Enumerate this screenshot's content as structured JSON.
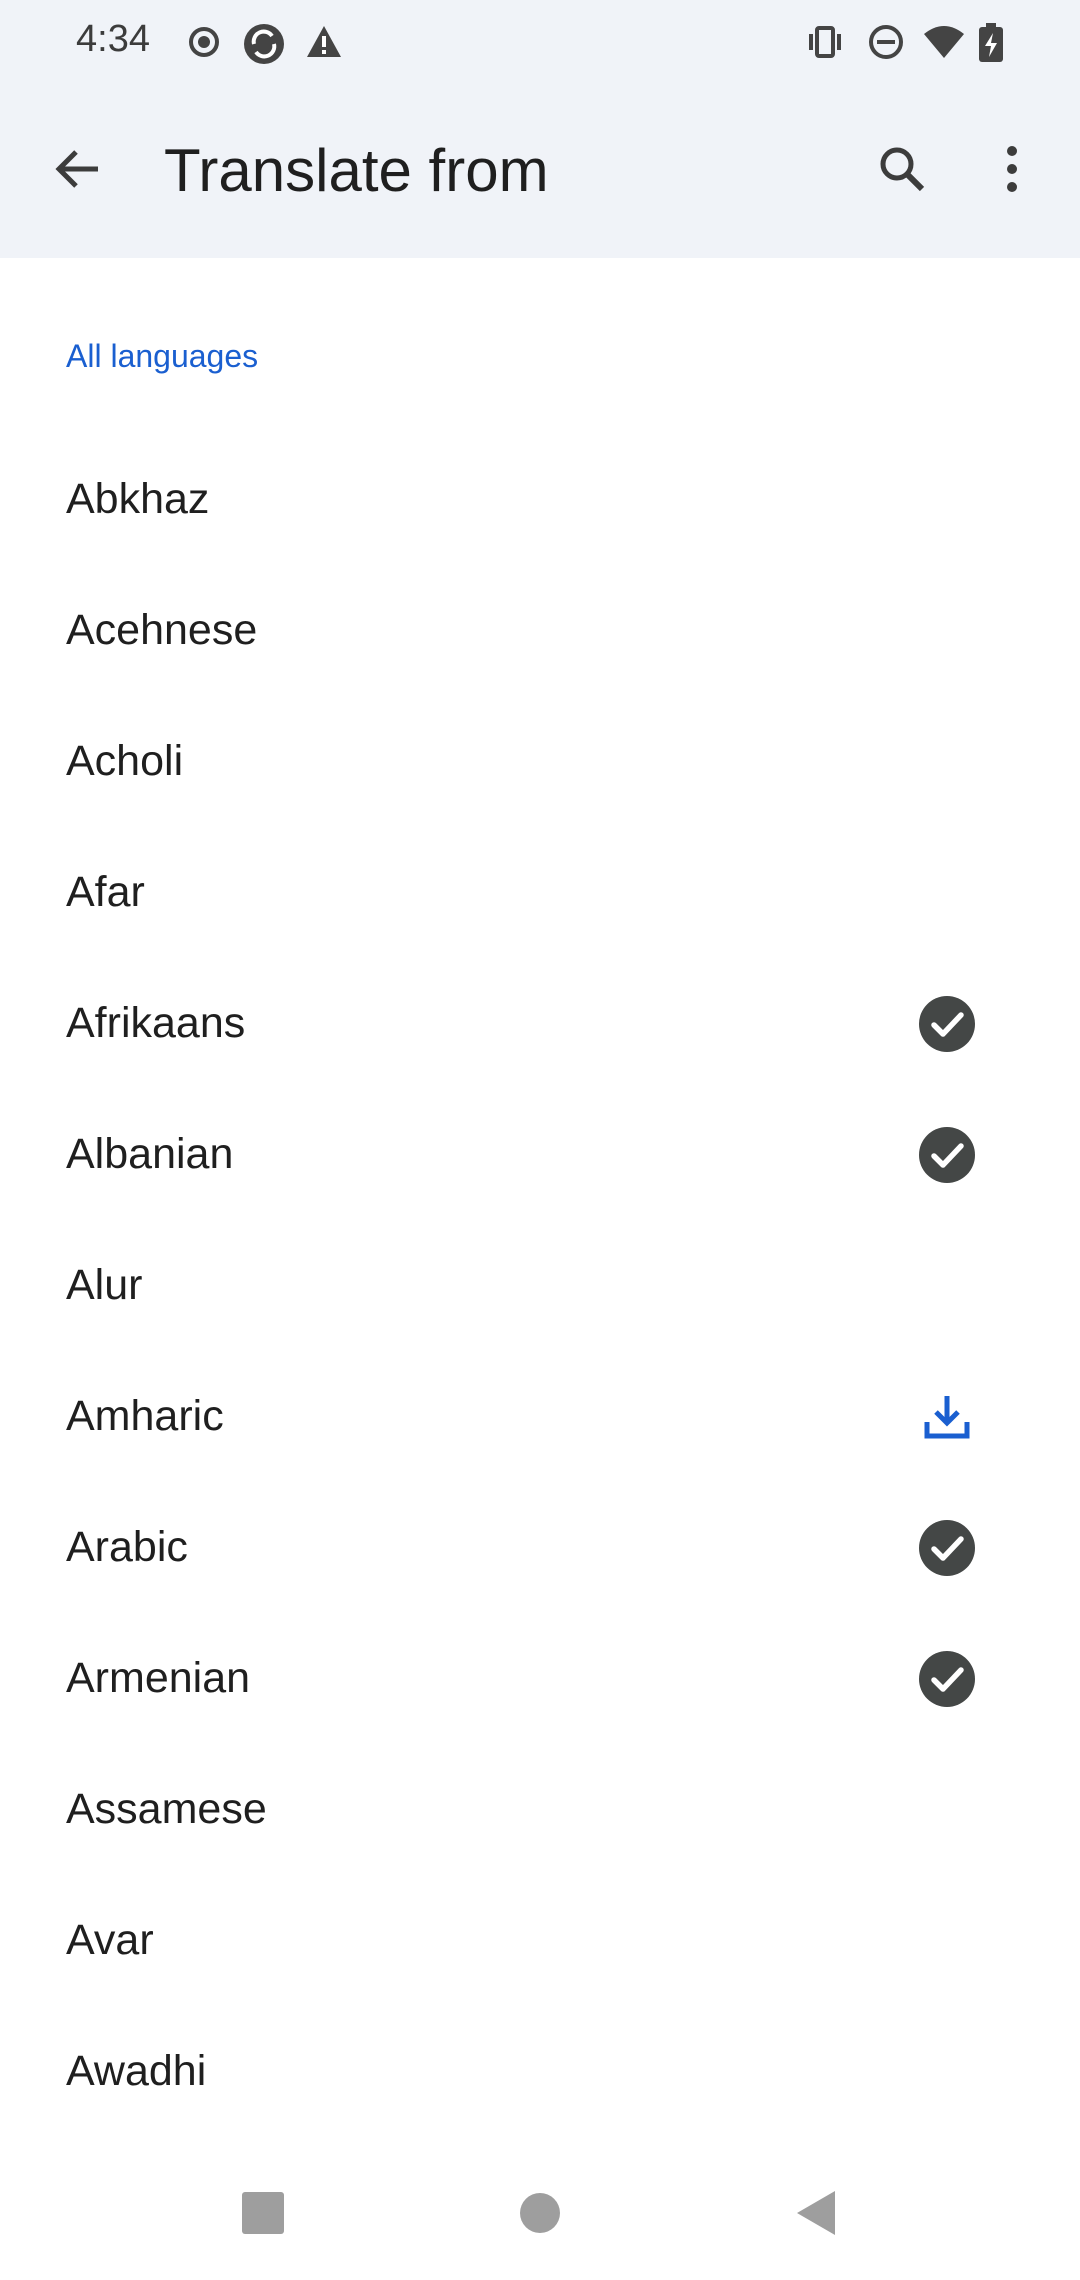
{
  "status_bar": {
    "time": "4:34",
    "icons_left": [
      "record-icon",
      "sync-icon",
      "warning-icon"
    ],
    "icons_right": [
      "vibrate-icon",
      "do-not-disturb-icon",
      "wifi-icon",
      "battery-charging-icon"
    ]
  },
  "app_bar": {
    "title": "Translate from",
    "back_icon": "back-arrow-icon",
    "search_icon": "search-icon",
    "more_icon": "more-vert-icon"
  },
  "section": {
    "header": "All languages"
  },
  "languages": [
    {
      "label": "Abkhaz",
      "status": "none"
    },
    {
      "label": "Acehnese",
      "status": "none"
    },
    {
      "label": "Acholi",
      "status": "none"
    },
    {
      "label": "Afar",
      "status": "none"
    },
    {
      "label": "Afrikaans",
      "status": "downloaded"
    },
    {
      "label": "Albanian",
      "status": "downloaded"
    },
    {
      "label": "Alur",
      "status": "none"
    },
    {
      "label": "Amharic",
      "status": "download"
    },
    {
      "label": "Arabic",
      "status": "downloaded"
    },
    {
      "label": "Armenian",
      "status": "downloaded"
    },
    {
      "label": "Assamese",
      "status": "none"
    },
    {
      "label": "Avar",
      "status": "none"
    },
    {
      "label": "Awadhi",
      "status": "none"
    }
  ],
  "nav_bar": {
    "icons": [
      "recents-square-icon",
      "home-circle-icon",
      "back-triangle-icon"
    ]
  },
  "colors": {
    "accent": "#1a5fd0",
    "downloaded_bg": "#444746",
    "appbar_bg": "#f0f3f8"
  }
}
